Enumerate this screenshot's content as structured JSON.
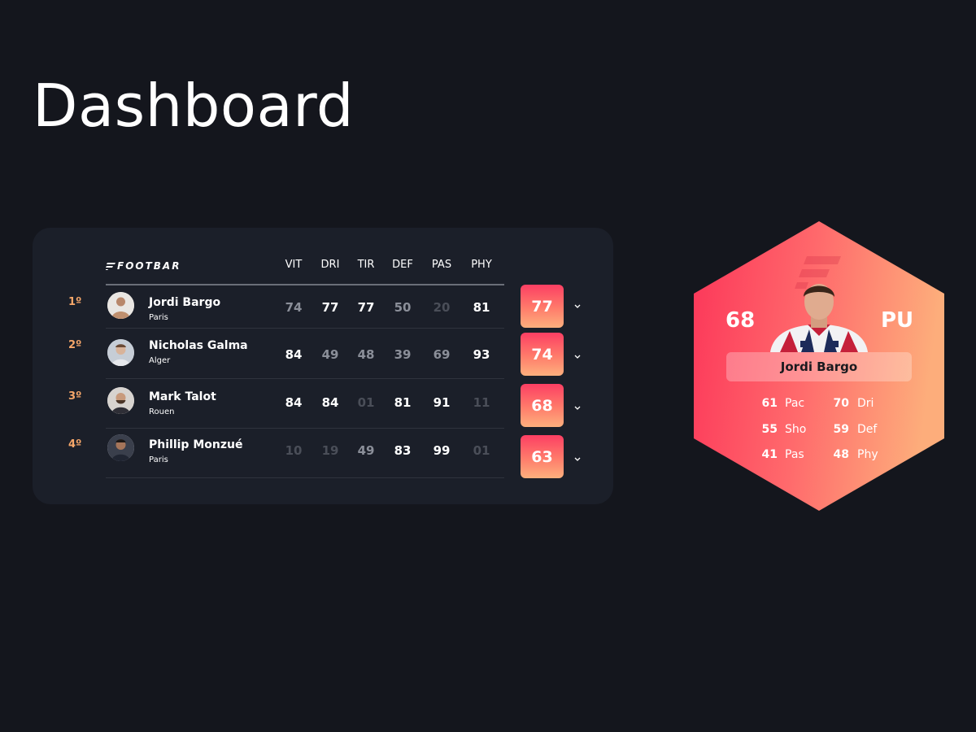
{
  "page": {
    "title": "Dashboard"
  },
  "table": {
    "logo_text": "FOOTBAR",
    "columns": [
      "VIT",
      "DRI",
      "TIR",
      "DEF",
      "PAS",
      "PHY"
    ],
    "rows": [
      {
        "rank": "1º",
        "name": "Jordi Bargo",
        "city": "Paris",
        "stats": [
          "74",
          "77",
          "77",
          "50",
          "20",
          "81"
        ],
        "stat_levels": [
          "mid",
          "hi",
          "hi",
          "mid",
          "lo",
          "hi"
        ],
        "score": "77"
      },
      {
        "rank": "2º",
        "name": "Nicholas Galma",
        "city": "Alger",
        "stats": [
          "84",
          "49",
          "48",
          "39",
          "69",
          "93"
        ],
        "stat_levels": [
          "hi",
          "mid",
          "mid",
          "mid",
          "mid",
          "hi"
        ],
        "score": "74"
      },
      {
        "rank": "3º",
        "name": "Mark Talot",
        "city": "Rouen",
        "stats": [
          "84",
          "84",
          "01",
          "81",
          "91",
          "11"
        ],
        "stat_levels": [
          "hi",
          "hi",
          "lo",
          "hi",
          "hi",
          "lo"
        ],
        "score": "68"
      },
      {
        "rank": "4º",
        "name": "Phillip Monzué",
        "city": "Paris",
        "stats": [
          "10",
          "19",
          "49",
          "83",
          "99",
          "01"
        ],
        "stat_levels": [
          "lo",
          "lo",
          "mid",
          "hi",
          "hi",
          "lo"
        ],
        "score": "63"
      }
    ]
  },
  "player_card": {
    "rating": "68",
    "position": "PU",
    "name": "Jordi Bargo",
    "stats": [
      {
        "value": "61",
        "label": "Pac"
      },
      {
        "value": "70",
        "label": "Dri"
      },
      {
        "value": "55",
        "label": "Sho"
      },
      {
        "value": "59",
        "label": "Def"
      },
      {
        "value": "41",
        "label": "Pas"
      },
      {
        "value": "48",
        "label": "Phy"
      }
    ]
  },
  "colors": {
    "background": "#14161d",
    "card": "#1b1f29",
    "accent_rank": "#f6a76a",
    "gradient_start": "#fc3f63",
    "gradient_end": "#fdb07d"
  },
  "icons": [
    "footbar-logo-icon",
    "chevron-down-icon",
    "avatar"
  ]
}
